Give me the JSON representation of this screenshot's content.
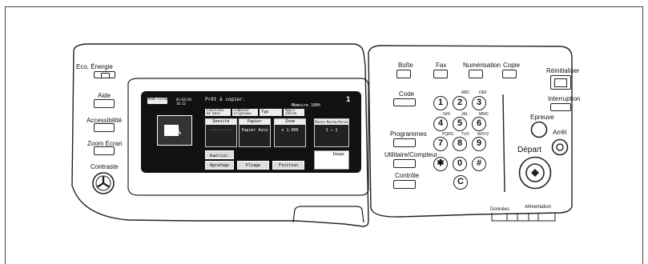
{
  "left_panel": {
    "eco_label": "Eco, Énergie",
    "aide_label": "Aide",
    "accessibilite_label": "Accessibilité",
    "zoom_label": "Zoom Ecran",
    "contraste_label": "Contraste"
  },
  "screen": {
    "status_icon_text": "Mode Ecran",
    "datetime": "01/05/05 10:22",
    "message": "Prêt à copier.",
    "memory": "Mémoire 100%",
    "copies": "1",
    "tabs": [
      "Fonctions de base",
      "Combiner originaux",
      "Typ orig",
      "Appli-cation"
    ],
    "functions": [
      {
        "title": "Densité",
        "value": "··········"
      },
      {
        "title": "Papier",
        "value": "Papier Auto"
      },
      {
        "title": "Zoom",
        "value": "x 1.000"
      },
      {
        "title": "Recto-Recto/Verso",
        "value": "1 → 1"
      }
    ],
    "bottom_buttons": [
      "Numérisat. séparée",
      "Agrafage",
      "Pliage",
      "Finition"
    ],
    "image_label": "Image"
  },
  "top_keys": {
    "boite": "Boîte",
    "fax": "Fax",
    "numerisation": "Numérisation",
    "copie": "Copie"
  },
  "mid_left": {
    "code": "Code",
    "programmes": "Programmes",
    "utilitaire": "Utilitaire/Compteur",
    "controle": "Contrôle"
  },
  "keypad": {
    "keys": [
      "1",
      "2",
      "3",
      "4",
      "5",
      "6",
      "7",
      "8",
      "9",
      "✱",
      "0",
      "#",
      "C"
    ],
    "letters": [
      "",
      "ABC",
      "DEF",
      "GHI",
      "JKL",
      "MNO",
      "PQRS",
      "TUV",
      "WXYZ"
    ]
  },
  "right_panel": {
    "reinitialiser": "Réinitialiser",
    "interruption": "Interruption",
    "epreuve": "Epreuve",
    "arret": "Arrêt",
    "depart": "Départ",
    "donnees": "Données",
    "alimentation": "Alimentation"
  }
}
